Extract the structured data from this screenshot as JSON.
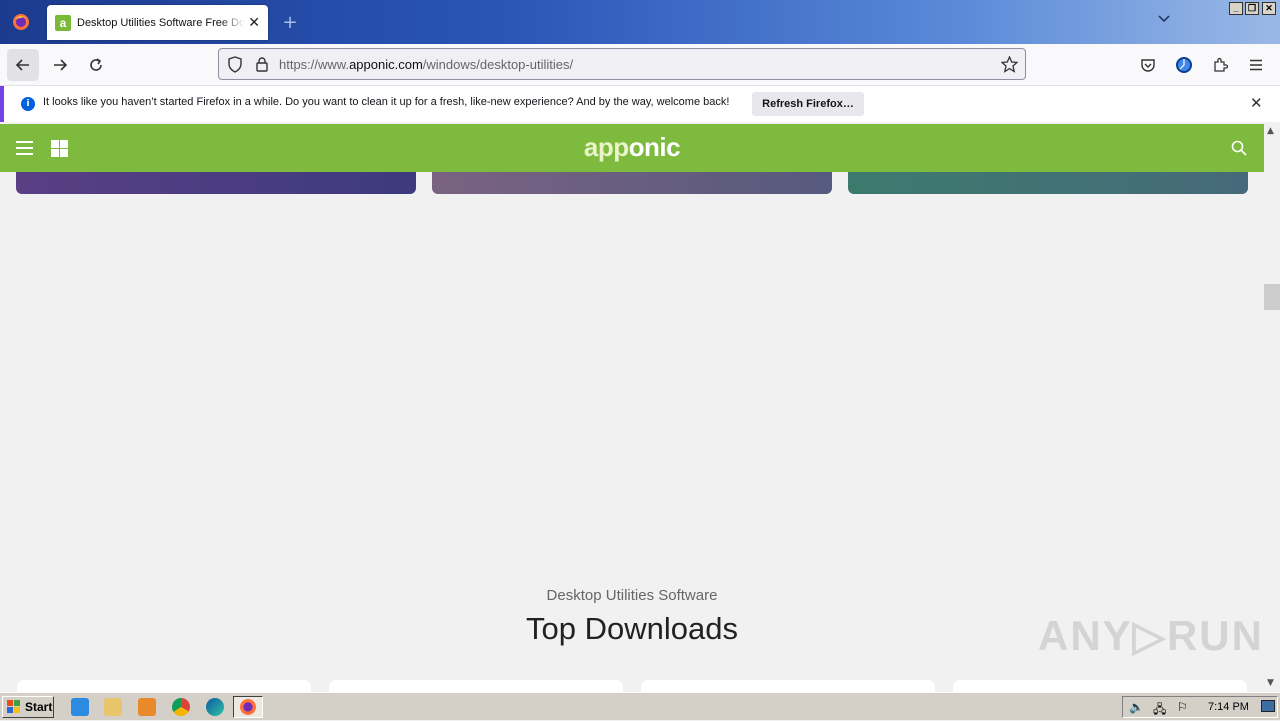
{
  "browser": {
    "tab_title": "Desktop Utilities Software Free Download",
    "tab_favicon_letter": "a",
    "url_prefix": "https://www.",
    "url_domain": "apponic.com",
    "url_path": "/windows/desktop-utilities/",
    "new_tab": "+",
    "close_symbol": "✕"
  },
  "notification": {
    "message": "It looks like you haven’t started Firefox in a while. Do you want to clean it up for a fresh, like-new experience? And by the way, welcome back!",
    "button_label": "Refresh Firefox…",
    "info_symbol": "i"
  },
  "site": {
    "logo_part1": "app",
    "logo_part2": "onic",
    "section_subtitle": "Desktop Utilities Software",
    "section_heading": "Top Downloads"
  },
  "watermark": "ANY▷RUN",
  "taskbar": {
    "start_label": "Start",
    "clock": "7:14 PM"
  },
  "colors": {
    "brand_green": "#7dba3e",
    "notification_accent": "#7542e5"
  }
}
